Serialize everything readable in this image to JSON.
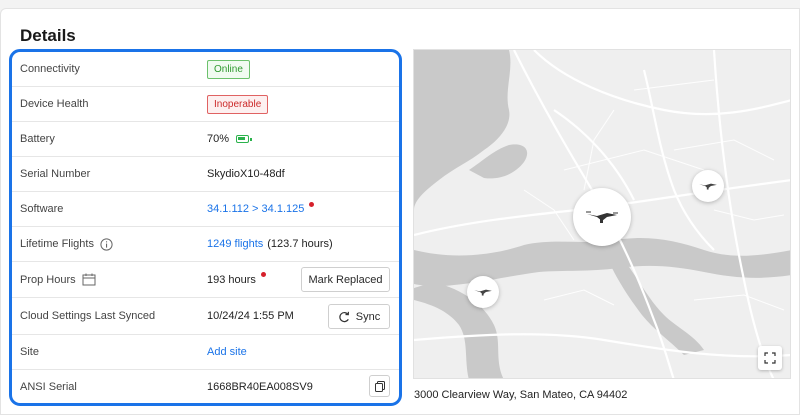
{
  "title": "Details",
  "rows": [
    {
      "label": "Connectivity",
      "value": "Online"
    },
    {
      "label": "Device Health",
      "value": "Inoperable"
    },
    {
      "label": "Battery",
      "value": "70%"
    },
    {
      "label": "Serial Number",
      "value": "SkydioX10-48df"
    },
    {
      "label": "Software",
      "value": "34.1.112 > 34.1.125"
    },
    {
      "label": "Lifetime Flights",
      "value": "1249 flights",
      "extra": "(123.7 hours)"
    },
    {
      "label": "Prop Hours",
      "value": "193 hours"
    },
    {
      "label": "Cloud Settings Last Synced",
      "value": "10/24/24 1:55 PM"
    },
    {
      "label": "Site",
      "value": "Add site"
    },
    {
      "label": "ANSI Serial",
      "value": "1668BR40EA008SV9"
    }
  ],
  "buttons": {
    "mark_replaced": "Mark Replaced",
    "sync": "Sync"
  },
  "map": {
    "address": "3000 Clearview Way, San Mateo, CA 94402"
  },
  "colors": {
    "accent": "#1a73e8",
    "online": "#2f9a2f",
    "error": "#cc2a2a",
    "battery": "#2bb24c"
  }
}
